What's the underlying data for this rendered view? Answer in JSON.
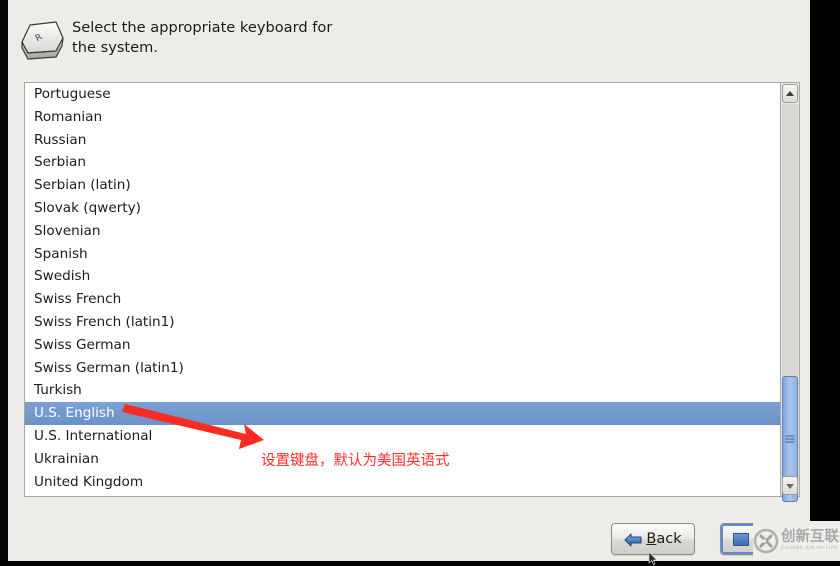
{
  "header": {
    "icon": "keyboard-key-icon",
    "key_letter": "R",
    "instruction": "Select the appropriate keyboard for the system."
  },
  "keyboard_list": {
    "name": "keyboard-layout-list",
    "selected": "U.S. English",
    "items": [
      "Portuguese",
      "Romanian",
      "Russian",
      "Serbian",
      "Serbian (latin)",
      "Slovak (qwerty)",
      "Slovenian",
      "Spanish",
      "Swedish",
      "Swiss French",
      "Swiss French (latin1)",
      "Swiss German",
      "Swiss German (latin1)",
      "Turkish",
      "U.S. English",
      "U.S. International",
      "Ukrainian",
      "United Kingdom"
    ]
  },
  "scrollbar": {
    "up_arrow": "scroll-up-icon",
    "down_arrow": "scroll-down-icon",
    "thumb_color": "#90b2e2"
  },
  "annotation": {
    "text": "设置键盘，默认为美国英语式",
    "color": "#ff2d2d",
    "arrow": "red-arrow-pointing-to-selected-item"
  },
  "footer": {
    "back_label_prefix": "B",
    "back_label_rest": "ack",
    "back_icon": "arrow-left-icon",
    "next_icon": "arrow-right-icon"
  },
  "watermark": {
    "cn": "创新互联",
    "en": "CHUANG XIN HU LIAN",
    "logo": "circle-x-logo"
  },
  "colors": {
    "selection_blue": "#6b92c8",
    "panel_bg": "#eeece9",
    "list_bg": "#ffffff",
    "annotation_red": "#ff2d2d"
  }
}
